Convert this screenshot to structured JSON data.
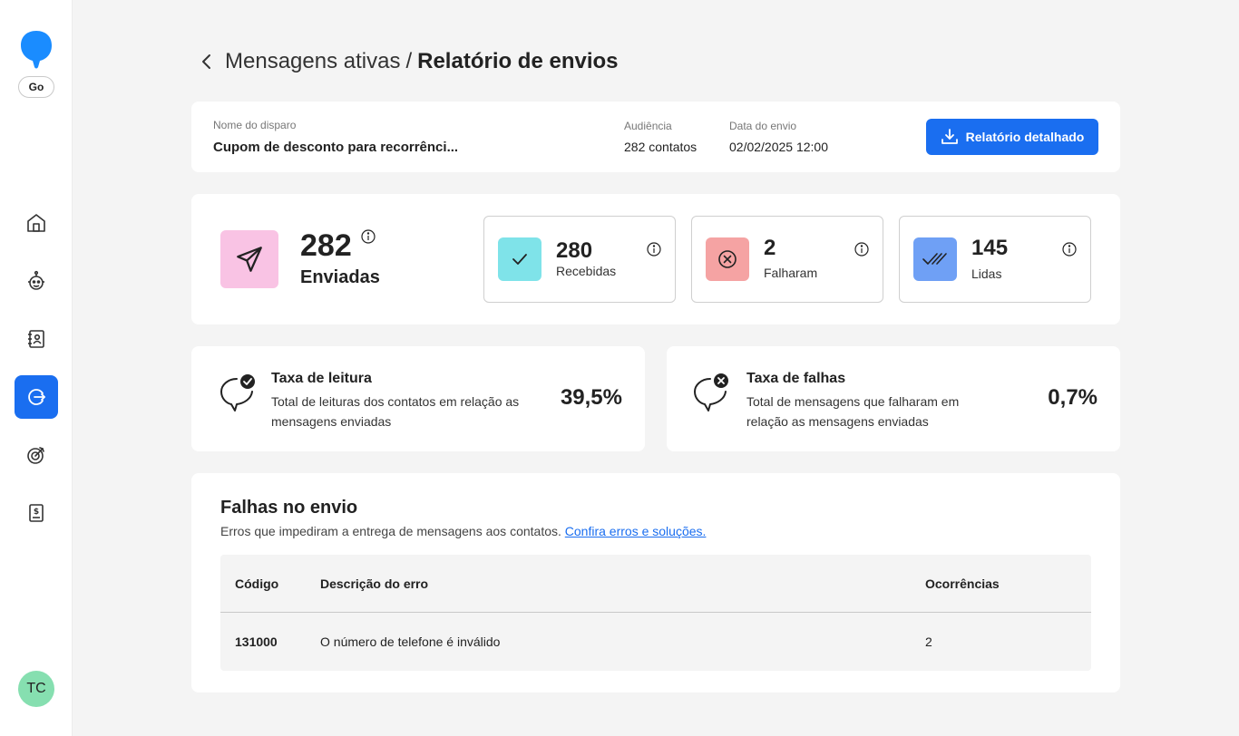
{
  "app": {
    "go_badge": "Go",
    "user_initials": "TC",
    "accent_color": "#1a6ef0"
  },
  "sidebar": {
    "items": [
      {
        "icon": "home-icon",
        "active": false
      },
      {
        "icon": "robot-icon",
        "active": false
      },
      {
        "icon": "contacts-book-icon",
        "active": false
      },
      {
        "icon": "active-messages-icon",
        "active": true
      },
      {
        "icon": "target-icon",
        "active": false
      },
      {
        "icon": "billing-icon",
        "active": false
      }
    ]
  },
  "header": {
    "parent": "Mensagens ativas",
    "separator": "/",
    "current": "Relatório de envios"
  },
  "info": {
    "name_label": "Nome do disparo",
    "name_value": "Cupom de desconto para recorrênci...",
    "audience_label": "Audiência",
    "audience_value": "282 contatos",
    "date_label": "Data do envio",
    "date_value": "02/02/2025 12:00",
    "report_button": "Relatório detalhado"
  },
  "stats": {
    "sent": {
      "value": "282",
      "label": "Enviadas"
    },
    "received": {
      "value": "280",
      "label": "Recebidas",
      "color": "#7fe3e9"
    },
    "failed": {
      "value": "2",
      "label": "Falharam",
      "color": "#f5a3a3"
    },
    "read": {
      "value": "145",
      "label": "Lidas",
      "color": "#6fa0f5"
    }
  },
  "rates": {
    "read": {
      "title": "Taxa de leitura",
      "description": "Total de leituras dos contatos em relação as mensagens enviadas",
      "value": "39,5%"
    },
    "fail": {
      "title": "Taxa de falhas",
      "description": "Total de mensagens que falharam em relação as mensagens enviadas",
      "value": "0,7%"
    }
  },
  "failures": {
    "title": "Falhas no envio",
    "subtitle": "Erros que impediram a entrega de mensagens aos contatos.",
    "link": "Confira erros e soluções.",
    "columns": [
      "Código",
      "Descrição do erro",
      "Ocorrências"
    ],
    "rows": [
      {
        "code": "131000",
        "description": "O número de telefone é inválido",
        "count": "2"
      }
    ]
  }
}
